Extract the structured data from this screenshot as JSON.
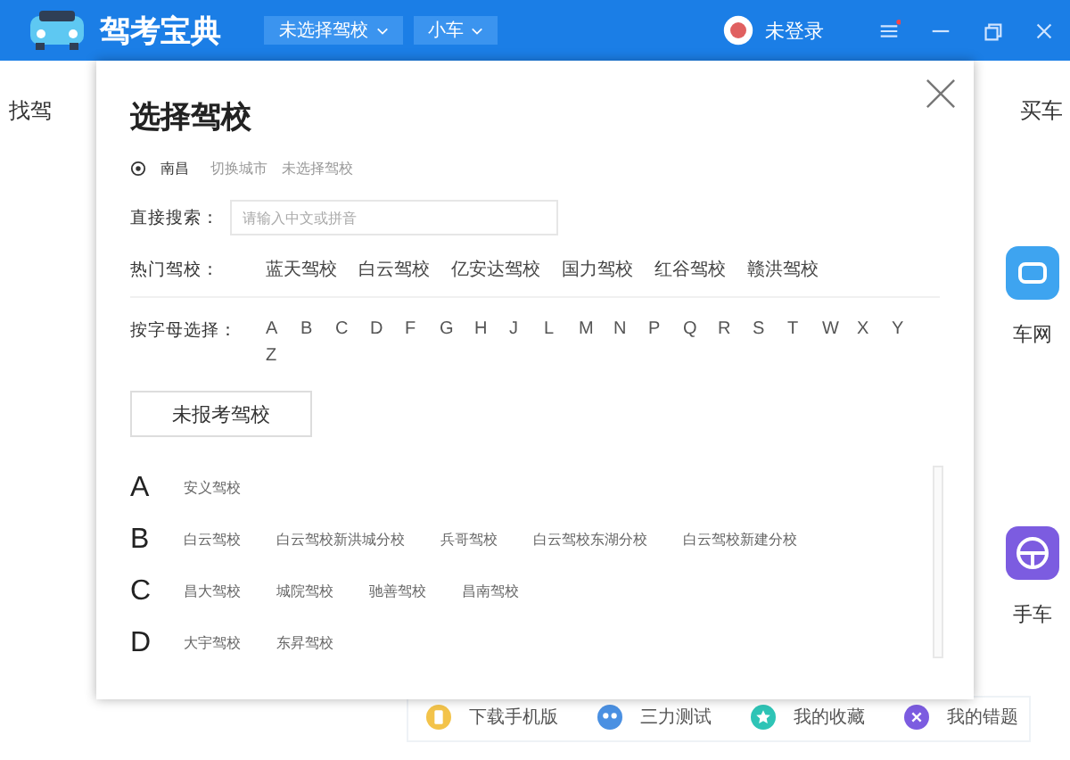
{
  "header": {
    "app_name": "驾考宝典",
    "school_dropdown": "未选择驾校",
    "car_dropdown": "小车",
    "user": "未登录",
    "has_notification": true
  },
  "background": {
    "nav_left": "找驾",
    "nav_right": "买车",
    "side_tiles": [
      {
        "label": "车网",
        "kind": "car"
      },
      {
        "label": "手车",
        "kind": "wheel"
      }
    ],
    "toolbar": [
      {
        "label": "下载手机版",
        "kind": "phone",
        "color": "#f3c34a"
      },
      {
        "label": "三力测试",
        "kind": "test",
        "color": "#4a90e2"
      },
      {
        "label": "我的收藏",
        "kind": "star",
        "color": "#2ec4b6"
      },
      {
        "label": "我的错题",
        "kind": "wrong",
        "color": "#7c5ce0"
      }
    ]
  },
  "modal": {
    "title": "选择驾校",
    "city": "南昌",
    "switch_city": "切换城市",
    "current_school": "未选择驾校",
    "search_label": "直接搜索：",
    "search_placeholder": "请输入中文或拼音",
    "hot_label": "热门驾校：",
    "hot_schools": [
      "蓝天驾校",
      "白云驾校",
      "亿安达驾校",
      "国力驾校",
      "红谷驾校",
      "赣洪驾校"
    ],
    "letter_label": "按字母选择：",
    "letters": [
      "A",
      "B",
      "C",
      "D",
      "F",
      "G",
      "H",
      "J",
      "L",
      "M",
      "N",
      "P",
      "Q",
      "R",
      "S",
      "T",
      "W",
      "X",
      "Y",
      "Z"
    ],
    "none_button": "未报考驾校",
    "groups": [
      {
        "letter": "A",
        "schools": [
          "安义驾校"
        ]
      },
      {
        "letter": "B",
        "schools": [
          "白云驾校",
          "白云驾校新洪城分校",
          "兵哥驾校",
          "白云驾校东湖分校",
          "白云驾校新建分校"
        ]
      },
      {
        "letter": "C",
        "schools": [
          "昌大驾校",
          "城院驾校",
          "驰善驾校",
          "昌南驾校"
        ]
      },
      {
        "letter": "D",
        "schools": [
          "大宇驾校",
          "东昇驾校"
        ]
      }
    ]
  }
}
